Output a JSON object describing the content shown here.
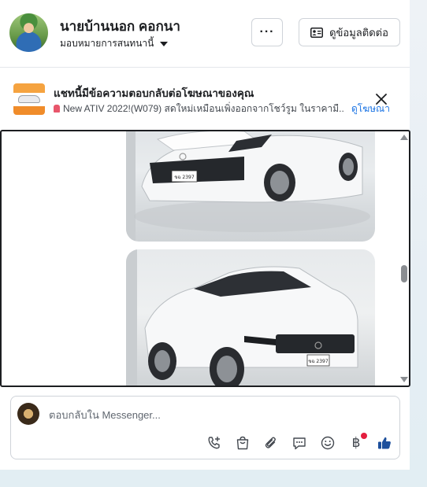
{
  "header": {
    "contact_name": "นายบ้านนอก คอกนา",
    "assigned_label": "มอบหมายการสนทนานี้",
    "more_button": "···",
    "contact_info_button": "ดูข้อมูลติดต่อ"
  },
  "ad_banner": {
    "title": "แชทนี้มีข้อความตอบกลับต่อโฆษณาของคุณ",
    "description": "New ATIV 2022!(W079) สดใหม่เหมือนเพิ่งออกจากโชว์รูม ในราคามื...",
    "view_ad_link": "ดูโฆษณา"
  },
  "thread": {
    "images": [
      {
        "plate": "ขฉ 2397"
      },
      {
        "plate": "ขฉ 2397"
      }
    ]
  },
  "composer": {
    "placeholder": "ตอบกลับใน Messenger...",
    "tools": [
      "call-add-icon",
      "shopping-bag-icon",
      "attachment-icon",
      "saved-replies-icon",
      "emoji-icon",
      "baht-payment-icon",
      "like-icon"
    ],
    "baht_symbol": "฿"
  },
  "colors": {
    "link": "#1b74e4",
    "border": "#cfd3d9",
    "notification": "#e41e3f"
  }
}
